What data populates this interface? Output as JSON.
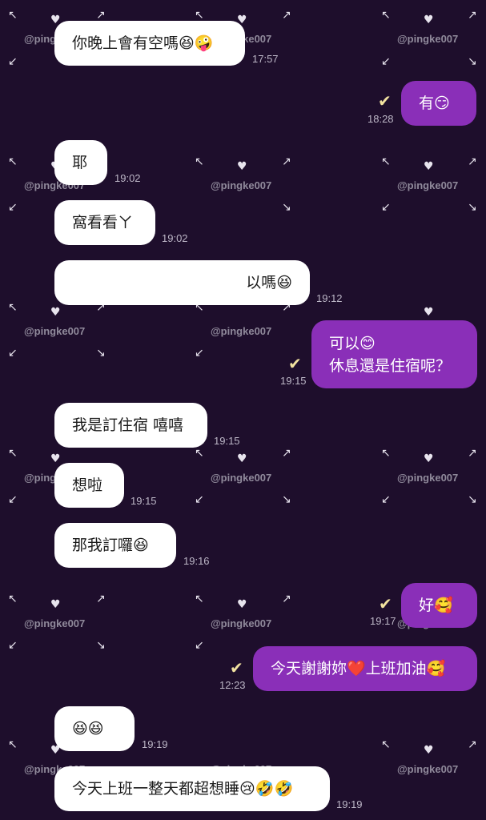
{
  "watermark": "@pingke007",
  "icons": {
    "read_receipt": "check-icon"
  },
  "colors": {
    "background": "#1e0e2c",
    "incoming_bubble": "#ffffff",
    "outgoing_bubble": "#8a2fb8",
    "read_tick": "#f2e2a0"
  },
  "messages": [
    {
      "side": "in",
      "text": "你晚上會有空嗎😆🤪",
      "time": "17:57"
    },
    {
      "side": "out",
      "text": "有😏",
      "time": "18:28"
    },
    {
      "side": "in",
      "text": "耶",
      "time": "19:02"
    },
    {
      "side": "in",
      "text": "窩看看ㄚ",
      "time": "19:02"
    },
    {
      "side": "in",
      "text": "以嗎😆",
      "time": "19:12"
    },
    {
      "side": "out",
      "line1": "可以😊",
      "line2": "休息還是住宿呢？",
      "time": "19:15"
    },
    {
      "side": "in",
      "text": "我是訂住宿 嘻嘻",
      "time": "19:15"
    },
    {
      "side": "in",
      "text": "想啦",
      "time": "19:15"
    },
    {
      "side": "in",
      "text": "那我訂囉😆",
      "time": "19:16"
    },
    {
      "side": "out",
      "text": "好🥰",
      "time": "19:17"
    },
    {
      "side": "out",
      "text": "今天謝謝妳❤️上班加油🥰",
      "time": "12:23"
    },
    {
      "side": "in",
      "text": "😆😆",
      "time": "19:19"
    },
    {
      "side": "in",
      "text": "今天上班一整天都超想睡😢🤣🤣",
      "time": "19:19"
    }
  ]
}
